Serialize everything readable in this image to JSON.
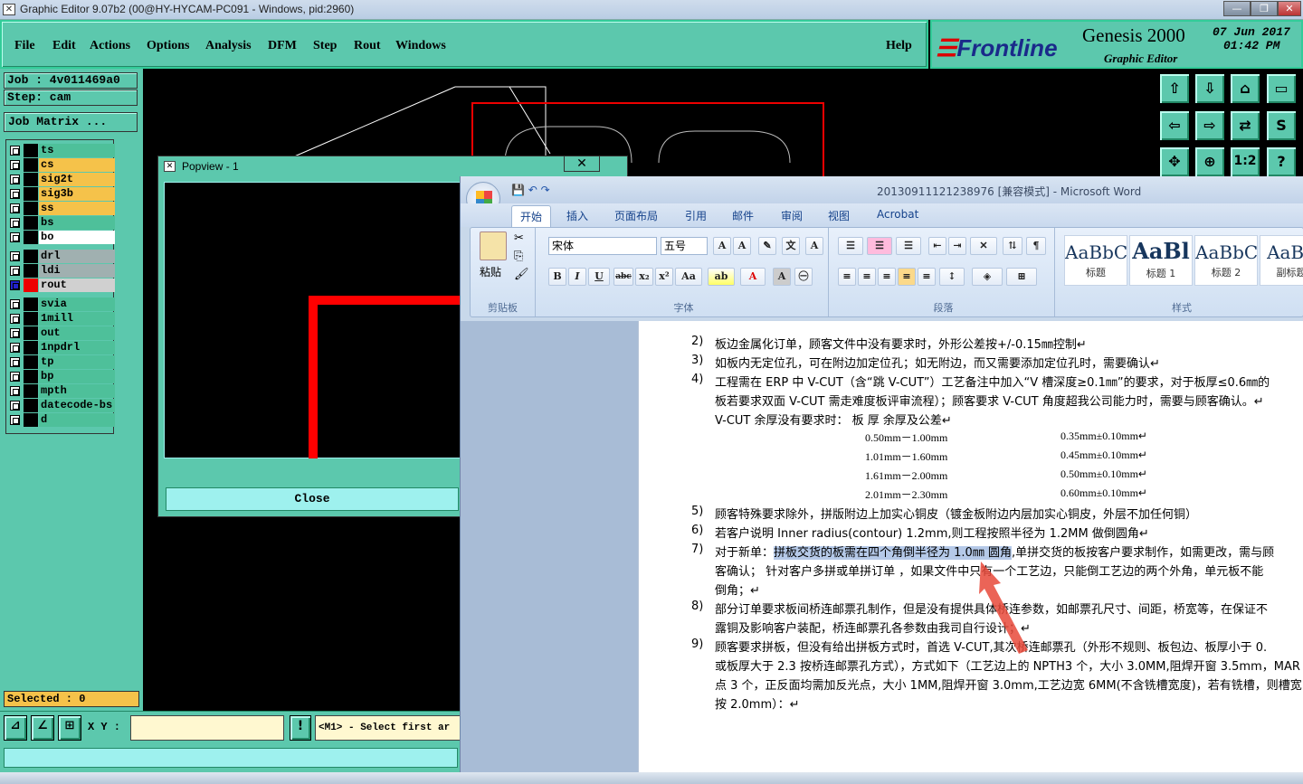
{
  "window": {
    "title": "Graphic Editor 9.07b2 (00@HY-HYCAM-PC091 - Windows, pid:2960)",
    "min": "—",
    "max": "❐",
    "close": "✕"
  },
  "menu": {
    "items": [
      "File",
      "Edit",
      "Actions",
      "Options",
      "Analysis",
      "DFM",
      "Step",
      "Rout",
      "Windows"
    ],
    "help": "Help"
  },
  "logo": {
    "brand": "Frontline",
    "product": "Genesis 2000",
    "subtitle": "Graphic Editor",
    "date": "07 Jun 2017",
    "time": "01:42 PM"
  },
  "job": {
    "job": "Job : 4v011469a0",
    "step": "Step: cam",
    "matrix": "Job Matrix ..."
  },
  "layers": [
    {
      "name": "ts",
      "color": "#4ec09a"
    },
    {
      "name": "cs",
      "color": "#f5c24a"
    },
    {
      "name": "sig2t",
      "color": "#f5c24a"
    },
    {
      "name": "sig3b",
      "color": "#f5c24a"
    },
    {
      "name": "ss",
      "color": "#f5c24a"
    },
    {
      "name": "bs",
      "color": "#4ec09a"
    },
    {
      "name": "bo",
      "color": "#ffffff"
    },
    {
      "name": "drl",
      "color": "#a0b0b0"
    },
    {
      "name": "ldi",
      "color": "#a0b0b0"
    },
    {
      "name": "rout",
      "color": "#d0d0d0"
    },
    {
      "name": "svia",
      "color": "#4ec09a"
    },
    {
      "name": "1mill",
      "color": "#4ec09a"
    },
    {
      "name": "out",
      "color": "#4ec09a"
    },
    {
      "name": "1npdrl",
      "color": "#4ec09a"
    },
    {
      "name": "tp",
      "color": "#4ec09a"
    },
    {
      "name": "bp",
      "color": "#4ec09a"
    },
    {
      "name": "mpth",
      "color": "#4ec09a"
    },
    {
      "name": "datecode-bs",
      "color": "#4ec09a"
    },
    {
      "name": "d",
      "color": "#4ec09a"
    }
  ],
  "selected": "Selected : 0",
  "coord": {
    "label": "X Y :",
    "value": "",
    "message": "<M1> - Select first ar"
  },
  "popview": {
    "title": "Popview - 1",
    "close": "Close"
  },
  "word": {
    "title": "20130911121238976 [兼容模式] - Microsoft Word",
    "tabs": [
      "开始",
      "插入",
      "页面布局",
      "引用",
      "邮件",
      "审阅",
      "视图",
      "Acrobat"
    ],
    "clipboard": {
      "paste": "粘贴",
      "label": "剪贴板"
    },
    "font": {
      "name": "宋体",
      "size": "五号",
      "label": "字体"
    },
    "paragraph": {
      "label": "段落"
    },
    "styles": {
      "label": "样式",
      "items": [
        {
          "preview": "AaBbC",
          "name": "标题"
        },
        {
          "preview": "AaBl",
          "name": "标题 1"
        },
        {
          "preview": "AaBbC",
          "name": "标题 2"
        },
        {
          "preview": "AaBb",
          "name": "副标题"
        }
      ]
    },
    "doc": {
      "lines": [
        {
          "n": "2)",
          "t": "板边金属化订单，顾客文件中没有要求时，外形公差按+/-0.15㎜控制↵"
        },
        {
          "n": "3)",
          "t": "如板内无定位孔，可在附边加定位孔；如无附边，而又需要添加定位孔时，需要确认↵"
        },
        {
          "n": "4)",
          "t": "工程需在 ERP 中 V-CUT（含“跳 V-CUT”）工艺备注中加入“V 槽深度≥0.1㎜”的要求，对于板厚≤0.6㎜的"
        },
        {
          "n": "",
          "t": "板若要求双面 V-CUT 需走难度板评审流程）；顾客要求 V-CUT 角度超我公司能力时，需要与顾客确认。↵"
        },
        {
          "n": "",
          "t": "V-CUT 余厚没有要求时：          板  厚                          余厚及公差↵"
        }
      ],
      "table": [
        [
          "0.50mm－1.00mm",
          "0.35mm±0.10mm↵"
        ],
        [
          "1.01mm－1.60mm",
          "0.45mm±0.10mm↵"
        ],
        [
          "1.61mm－2.00mm",
          "0.50mm±0.10mm↵"
        ],
        [
          "2.01mm－2.30mm",
          "0.60mm±0.10mm↵"
        ]
      ],
      "lines2": [
        {
          "n": "5)",
          "t": "顾客特殊要求除外，拼版附边上加实心铜皮（镀金板附边内层加实心铜皮，外层不加任何铜）"
        },
        {
          "n": "6)",
          "t": "若客户说明 Inner radius(contour) 1.2mm,则工程按照半径为 1.2MM 做倒圆角↵"
        },
        {
          "n": "7)",
          "pre": "对于新单：",
          "hl": "拼板交货的板需在四个角倒半径为 1.0㎜ 圆角",
          "post": ",单拼交货的板按客户要求制作，如需更改，需与顾"
        },
        {
          "n": "",
          "t": "客确认；  针对客户多拼或单拼订单 ，如果文件中只有一个工艺边，只能倒工艺边的两个外角，单元板不能"
        },
        {
          "n": "",
          "t": "倒角；↵"
        },
        {
          "n": "8)",
          "t": "部分订单要求板间桥连邮票孔制作，但是没有提供具体桥连参数，如邮票孔尺寸、间距，桥宽等，在保证不"
        },
        {
          "n": "",
          "t": "露铜及影响客户装配，桥连邮票孔各参数由我司自行设计；↵"
        },
        {
          "n": "9)",
          "t": "顾客要求拼板，但没有给出拼板方式时，首选 V-CUT,其次桥连邮票孔（外形不规则、板包边、板厚小于 0."
        },
        {
          "n": "",
          "t": "或板厚大于 2.3 按桥连邮票孔方式），方式如下（工艺边上的 NPTH3 个，大小 3.0MM,阻焊开窗 3.5mm，MAR"
        },
        {
          "n": "",
          "t": "点 3 个，正反面均需加反光点，大小 1MM,阻焊开窗 3.0mm,工艺边宽 6MM(不含铣槽宽度)，若有铣槽，则槽宽"
        },
        {
          "n": "",
          "t": "按 2.0mm）：↵"
        }
      ]
    }
  }
}
